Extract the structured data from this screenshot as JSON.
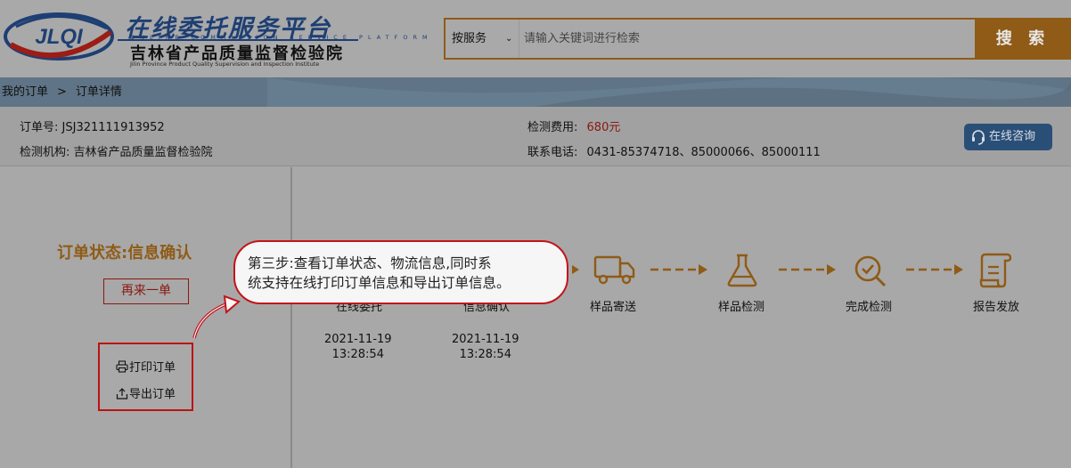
{
  "header": {
    "logo_text": "JLQI",
    "title": "在线委托服务平台",
    "title_en": "ONLINE COMMISSION SERVICE PLATFORM",
    "subtitle": "吉林省产品质量监督检验院",
    "subtitle_en": "Jilin Province Product Quality Supervision and Inspection Institute"
  },
  "search": {
    "scope_selected": "按服务",
    "placeholder": "请输入关键词进行检索",
    "button": "搜 索"
  },
  "breadcrumb": {
    "root": "我的订单",
    "separator": ">",
    "current": "订单详情"
  },
  "order": {
    "number_label": "订单号:",
    "number": "JSJ321111913952",
    "fee_label": "检测费用:",
    "fee": "680元",
    "org_label": "检测机构:",
    "org": "吉林省产品质量监督检验院",
    "phone_label": "联系电话:",
    "phone": "0431-85374718、85000066、85000111",
    "consult_button": "在线咨询"
  },
  "status": {
    "title": "订单状态:信息确认",
    "reorder_button": "再来一单",
    "actions": {
      "print": "打印订单",
      "export": "导出订单"
    }
  },
  "steps": [
    {
      "label": "在线委托",
      "date": "2021-11-19",
      "time": "13:28:54"
    },
    {
      "label": "信息确认",
      "date": "2021-11-19",
      "time": "13:28:54"
    },
    {
      "label": "样品寄送",
      "icon": "truck-icon"
    },
    {
      "label": "样品检测",
      "icon": "flask-icon"
    },
    {
      "label": "完成检测",
      "icon": "magnifier-check-icon"
    },
    {
      "label": "报告发放",
      "icon": "report-scroll-icon"
    }
  ],
  "tutorial": {
    "line1": "第三步:查看订单状态、物流信息,同时系",
    "line2": "统支持在线打印订单信息和导出订单信息。"
  },
  "colors": {
    "accent": "#8f5b17",
    "fee": "#8a1810",
    "highlight": "#c2141a",
    "consult": "#2a4f77"
  }
}
